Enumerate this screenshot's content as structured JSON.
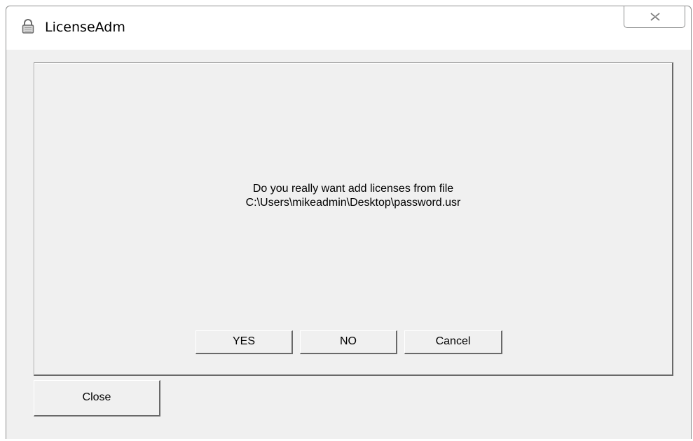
{
  "window": {
    "title": "LicenseAdm",
    "title_icon": "lock-icon",
    "close_icon": "close-icon"
  },
  "dialog": {
    "message_line1": "Do you really want add licenses from file",
    "message_line2": "C:\\Users\\mikeadmin\\Desktop\\password.usr",
    "yes_label": "YES",
    "no_label": "NO",
    "cancel_label": "Cancel"
  },
  "footer": {
    "close_label": "Close"
  },
  "colors": {
    "face": "#f0f0f0",
    "shadow": "#696969",
    "highlight": "#ffffff",
    "frame": "#8e8f8f"
  }
}
